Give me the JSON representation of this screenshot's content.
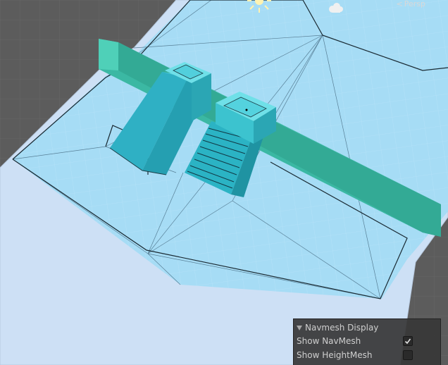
{
  "scene": {
    "projection_label": "Persp",
    "projection_arrow": "<",
    "icons": [
      "sun-icon",
      "cloud-icon",
      "checkmark-icon",
      "foldout-arrow-icon"
    ]
  },
  "navmesh_panel": {
    "title": "Navmesh Display",
    "show_navmesh_label": "Show NavMesh",
    "show_navmesh_checked": true,
    "show_heightmesh_label": "Show HeightMesh",
    "show_heightmesh_checked": false
  },
  "colors": {
    "background": "#5c5c5c",
    "floor_outer": "#cde0f5",
    "navmesh": "#a6dcf5",
    "geometry": "#3fbfc0"
  }
}
